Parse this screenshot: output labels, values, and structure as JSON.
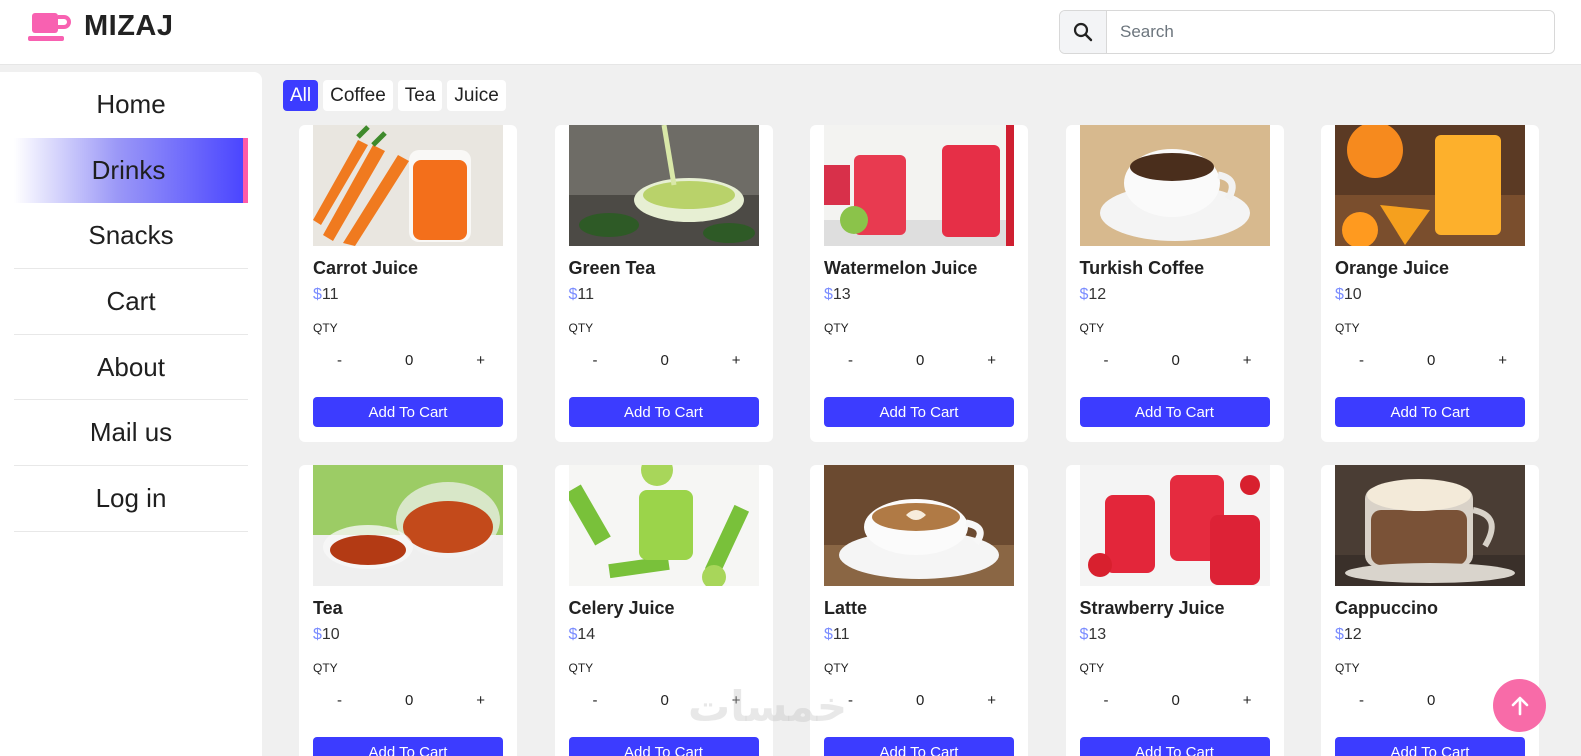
{
  "brand": {
    "name": "MIZAJ",
    "icon": "cup-icon",
    "color": "#f861b1"
  },
  "search": {
    "placeholder": "Search",
    "value": ""
  },
  "nav": {
    "items": [
      {
        "label": "Home"
      },
      {
        "label": "Drinks",
        "active": true
      },
      {
        "label": "Snacks"
      },
      {
        "label": "Cart"
      },
      {
        "label": "About"
      },
      {
        "label": "Mail us"
      },
      {
        "label": "Log in"
      }
    ]
  },
  "filters": [
    {
      "label": "All",
      "active": true
    },
    {
      "label": "Coffee"
    },
    {
      "label": "Tea"
    },
    {
      "label": "Juice"
    }
  ],
  "currency": "$",
  "qty_label": "QTY",
  "add_label": "Add To Cart",
  "products": [
    {
      "name": "Carrot Juice",
      "price": "11",
      "qty": "0"
    },
    {
      "name": "Green Tea",
      "price": "11",
      "qty": "0"
    },
    {
      "name": "Watermelon Juice",
      "price": "13",
      "qty": "0"
    },
    {
      "name": "Turkish Coffee",
      "price": "12",
      "qty": "0"
    },
    {
      "name": "Orange Juice",
      "price": "10",
      "qty": "0"
    },
    {
      "name": "Tea",
      "price": "10",
      "qty": "0"
    },
    {
      "name": "Celery Juice",
      "price": "14",
      "qty": "0"
    },
    {
      "name": "Latte",
      "price": "11",
      "qty": "0"
    },
    {
      "name": "Strawberry Juice",
      "price": "13",
      "qty": "0"
    },
    {
      "name": "Cappuccino",
      "price": "12",
      "qty": "0"
    }
  ],
  "watermark": "خمسات",
  "colors": {
    "accent": "#3c3cff",
    "pink": "#f86ba8",
    "price_symbol": "#7a8cff"
  }
}
